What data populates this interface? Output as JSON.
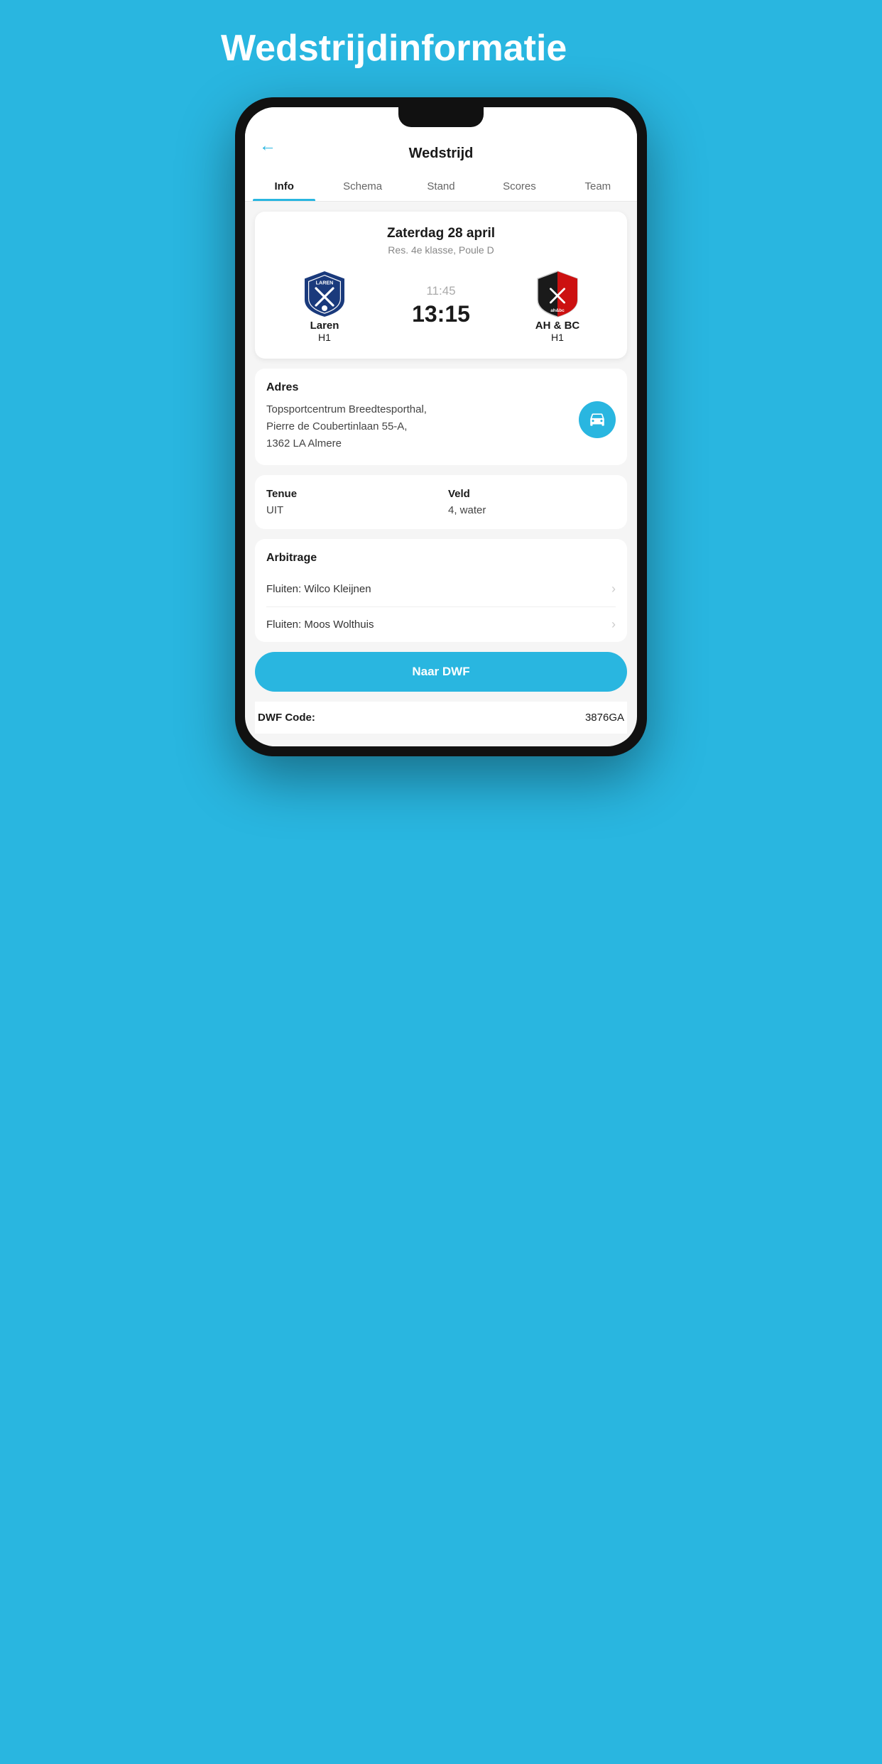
{
  "page": {
    "heading": "Wedstrijdinformatie"
  },
  "header": {
    "back_label": "←",
    "title": "Wedstrijd"
  },
  "tabs": [
    {
      "id": "info",
      "label": "Info",
      "active": true
    },
    {
      "id": "schema",
      "label": "Schema",
      "active": false
    },
    {
      "id": "stand",
      "label": "Stand",
      "active": false
    },
    {
      "id": "scores",
      "label": "Scores",
      "active": false
    },
    {
      "id": "team",
      "label": "Team",
      "active": false
    }
  ],
  "match": {
    "date": "Zaterdag 28 april",
    "league": "Res. 4e klasse, Poule D",
    "home_team": "Laren",
    "home_sub": "H1",
    "away_team": "AH & BC",
    "away_sub": "H1",
    "time_planned": "11:45",
    "time_actual": "13:15"
  },
  "address": {
    "label": "Adres",
    "text_line1": "Topsportcentrum Breedtesporthal,",
    "text_line2": "Pierre de Coubertinlaan 55-A,",
    "text_line3": "1362 LA Almere"
  },
  "tenue": {
    "label": "Tenue",
    "value": "UIT"
  },
  "veld": {
    "label": "Veld",
    "value": "4, water"
  },
  "arbitrage": {
    "label": "Arbitrage",
    "referees": [
      {
        "text": "Fluiten: Wilco Kleijnen"
      },
      {
        "text": "Fluiten: Moos Wolthuis"
      }
    ]
  },
  "dwf_button": {
    "label": "Naar DWF"
  },
  "dwf_code": {
    "label": "DWF Code:",
    "value": "3876GA"
  }
}
